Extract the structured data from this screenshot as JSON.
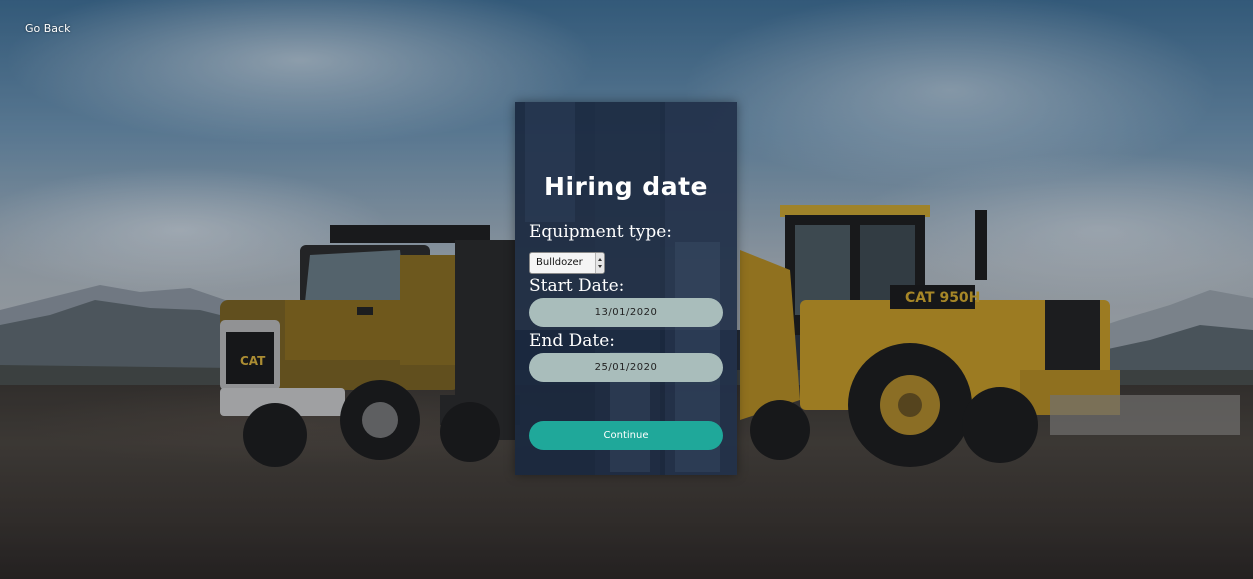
{
  "nav": {
    "go_back_label": "Go Back"
  },
  "form": {
    "title": "Hiring date",
    "equipment_label": "Equipment type:",
    "equipment_value": "Bulldozer",
    "start_label": "Start Date:",
    "start_value": "13/01/2020",
    "end_label": "End Date:",
    "end_value": "25/01/2020",
    "continue_label": "Continue"
  },
  "colors": {
    "panel": "#19263c",
    "date_field": "#a9bdbb",
    "continue_button": "#1fa89a"
  },
  "background": {
    "icons": [
      "dump-truck-illustration",
      "wheel-loader-illustration"
    ],
    "truck_badge": "CAT",
    "loader_badge": "CAT 950H"
  }
}
